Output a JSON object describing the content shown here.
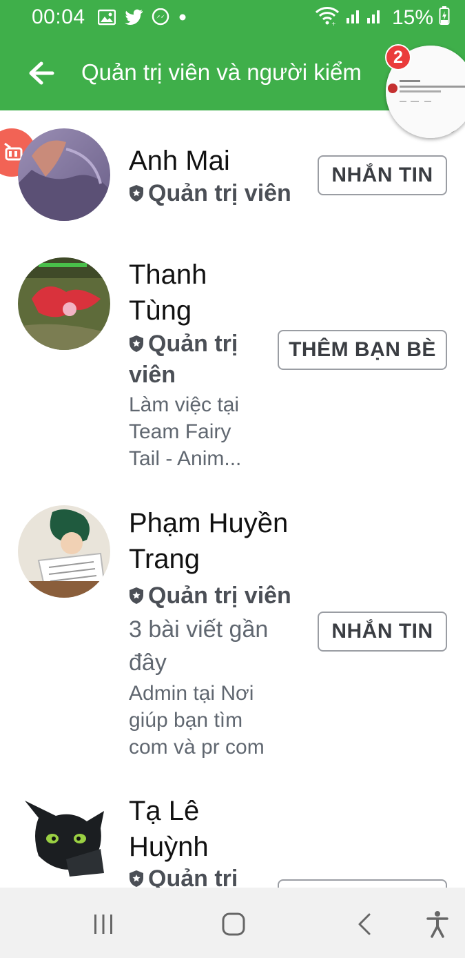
{
  "status_bar": {
    "time": "00:04",
    "battery": "15%",
    "icons": [
      "gallery-icon",
      "twitter-icon",
      "messenger-icon",
      "dot-icon",
      "wifi-icon",
      "signal-icon",
      "battery-icon"
    ]
  },
  "app_bar": {
    "title": "Quản trị viên và người kiểm",
    "back_icon": "arrow-left-icon"
  },
  "chat_head": {
    "badge_count": "2"
  },
  "members": [
    {
      "name": "Anh Mai",
      "role": "Quản trị viên",
      "action": "NHẮN TIN"
    },
    {
      "name_line1": "Thanh",
      "name_line2": "Tùng",
      "role_line1": "Quản trị",
      "role_line2": "viên",
      "sub_line1": "Làm việc tại",
      "sub_line2": "Team Fairy",
      "sub_line3": "Tail - Anim...",
      "action": "THÊM BẠN BÈ"
    },
    {
      "name_line1": "Phạm Huyền",
      "name_line2": "Trang",
      "role": "Quản trị viên",
      "posts_line1": "3 bài viết gần",
      "posts_line2": "đây",
      "sub_line1": "Admin tại Nơi",
      "sub_line2": "giúp bạn tìm",
      "sub_line3": "com và pr com",
      "action": "NHẮN TIN"
    },
    {
      "name_line1": "Tạ Lê",
      "name_line2": "Huỳnh",
      "role_line1": "Quản trị"
    }
  ],
  "colors": {
    "header_green": "#3faf4a",
    "badge_red": "#ea3b3b",
    "camera_red": "#f26355"
  },
  "nav_bar": {
    "icons": [
      "recent-apps-icon",
      "home-icon",
      "back-icon",
      "accessibility-icon"
    ]
  }
}
